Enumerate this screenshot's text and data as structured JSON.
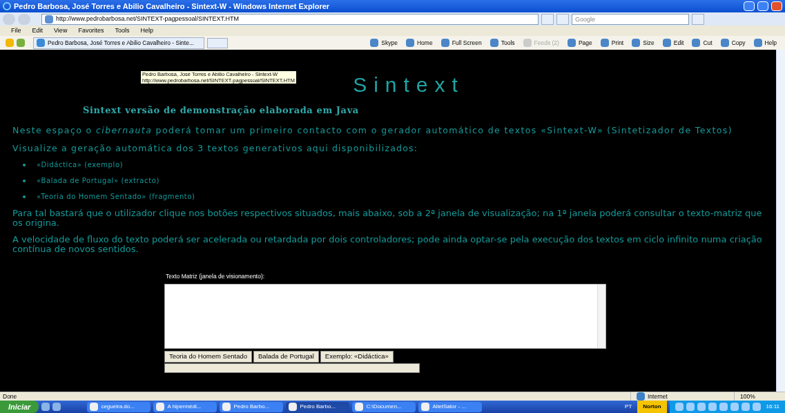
{
  "window": {
    "title": "Pedro Barbosa, José Torres e Abilio Cavalheiro - Sintext-W - Windows Internet Explorer"
  },
  "address_bar": {
    "url": "http://www.pedrobarbosa.net/SINTEXT-pagpessoal/SINTEXT.HTM"
  },
  "search": {
    "placeholder": "Google"
  },
  "menu": [
    "File",
    "Edit",
    "View",
    "Favorites",
    "Tools",
    "Help"
  ],
  "tab": {
    "label": "Pedro Barbosa, José Torres e Abilio Cavalheiro - Sinte..."
  },
  "command_bar": [
    {
      "label": "Skype",
      "disabled": false
    },
    {
      "label": "Home",
      "disabled": false
    },
    {
      "label": "Full Screen",
      "disabled": false
    },
    {
      "label": "Tools",
      "disabled": false
    },
    {
      "label": "Feeds (2)",
      "disabled": true
    },
    {
      "label": "Page",
      "disabled": false
    },
    {
      "label": "Print",
      "disabled": false
    },
    {
      "label": "Size",
      "disabled": false
    },
    {
      "label": "Edit",
      "disabled": false
    },
    {
      "label": "Cut",
      "disabled": false
    },
    {
      "label": "Copy",
      "disabled": false
    },
    {
      "label": "Help",
      "disabled": false
    }
  ],
  "tooltip": [
    "Pedro Barbosa, José Torres e Abilio Cavalheiro - Sintext-W",
    "http://www.pedrobarbosa.net/SINTEXT-pagpessoal/SINTEXT.HTM"
  ],
  "page": {
    "logo": "Sintext",
    "heading": "Sintext versão de demonstração elaborada em Java",
    "intro": "Neste espaço o *cibernauta* poderá tomar um primeiro contacto com o gerador automático de textos «Sintext-W» (Sintetizador de Textos)",
    "list_intro": "Visualize a geração automática dos 3 textos generativos aqui disponibilizados:",
    "list": [
      "«Didáctica» (exemplo)",
      "«Balada de Portugal» (extracto)",
      "«Teoria do Homem Sentado» (fragmento)"
    ],
    "paragraphs": [
      "Para tal bastará que o utilizador clique nos botões respectivos situados, mais abaixo, sob a 2ª janela de visualização; na 1ª janela poderá consultar o texto-matriz que os origina.",
      "A velocidade de fluxo do texto poderá ser acelerada ou retardada por dois controladores; pode ainda optar-se pela execução dos textos em ciclo infinito numa criação contínua de novos sentidos."
    ],
    "textarea_label": "Texto Matriz (janela de visionamento):",
    "buttons": [
      "Teoria do Homem Sentado",
      "Balada de Portugal",
      "Exemplo: «Didáctica»"
    ]
  },
  "status_bar": {
    "status": "Done",
    "zone": "Internet",
    "zoom": "100%"
  },
  "taskbar": {
    "start": "Iniciar",
    "tasks": [
      {
        "label": "cegueira.do...",
        "selected": false
      },
      {
        "label": "A hipermédi...",
        "selected": false
      },
      {
        "label": "Pedro Barbo...",
        "selected": false
      },
      {
        "label": "Pedro Barbo...",
        "selected": true
      },
      {
        "label": "C:\\Documen...",
        "selected": false
      },
      {
        "label": "AlletSator - ...",
        "selected": false
      }
    ],
    "language": "PT",
    "norton": "Norton",
    "clock": "16:11"
  }
}
